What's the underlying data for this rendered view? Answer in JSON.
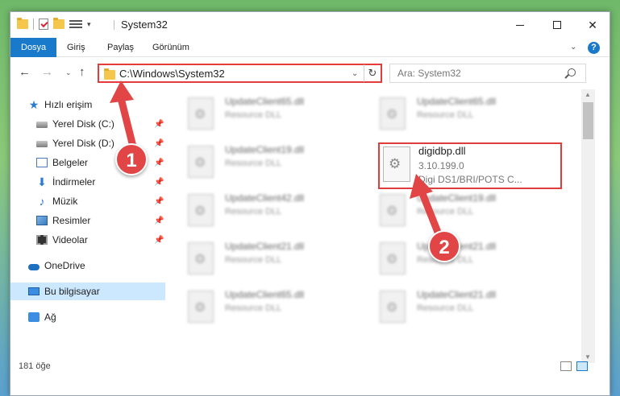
{
  "window": {
    "title": "System32",
    "colors": {
      "accent": "#1979ca",
      "highlight": "#e03c3c",
      "selected": "#cce8ff"
    }
  },
  "ribbon": {
    "tabs": [
      "Dosya",
      "Giriş",
      "Paylaş",
      "Görünüm"
    ]
  },
  "address_bar": {
    "path": "C:\\Windows\\System32"
  },
  "search": {
    "placeholder": "Ara: System32"
  },
  "sidebar": {
    "items": [
      {
        "label": "Hızlı erişim",
        "icon": "star-icon"
      },
      {
        "label": "Yerel Disk (C:)",
        "icon": "drive-icon",
        "pinned": true
      },
      {
        "label": "Yerel Disk (D:)",
        "icon": "drive-icon",
        "pinned": true
      },
      {
        "label": "Belgeler",
        "icon": "documents-icon",
        "pinned": true
      },
      {
        "label": "İndirmeler",
        "icon": "download-icon",
        "pinned": true
      },
      {
        "label": "Müzik",
        "icon": "music-icon",
        "pinned": true
      },
      {
        "label": "Resimler",
        "icon": "pictures-icon",
        "pinned": true
      },
      {
        "label": "Videolar",
        "icon": "videos-icon",
        "pinned": true
      },
      {
        "label": "OneDrive",
        "icon": "cloud-icon"
      },
      {
        "label": "Bu bilgisayar",
        "icon": "computer-icon",
        "selected": true
      },
      {
        "label": "Ağ",
        "icon": "network-icon"
      }
    ]
  },
  "files": {
    "left_column": [
      {
        "name": "UpdateClient65.dll",
        "desc": "Resource DLL"
      },
      {
        "name": "UpdateClient19.dll",
        "desc": "Resource DLL"
      },
      {
        "name": "UpdateClient42.dll",
        "desc": "Resource DLL"
      },
      {
        "name": "UpdateClient21.dll",
        "desc": "Resource DLL"
      },
      {
        "name": "UpdateClient65.dll",
        "desc": "Resource DLL"
      }
    ],
    "right_column": [
      {
        "name": "UpdateClient65.dll",
        "desc": "Resource DLL"
      },
      {
        "name": "UpdateClient19.dll",
        "desc": "Resource DLL"
      },
      {
        "name": "UpdateClient21.dll",
        "desc": "Resource DLL"
      },
      {
        "name": "UpdateClient21.dll",
        "desc": "Resource DLL"
      }
    ],
    "highlighted": {
      "name": "digidbp.dll",
      "version": "3.10.199.0",
      "desc": "Digi DS1/BRI/POTS C..."
    }
  },
  "status": {
    "count": "181 öğe"
  },
  "annotations": {
    "step1": "1",
    "step2": "2"
  }
}
